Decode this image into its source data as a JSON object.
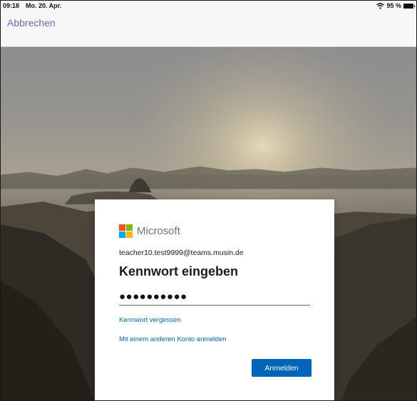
{
  "statusbar": {
    "time": "09:18",
    "date": "Mo. 20. Apr.",
    "battery": "95 %"
  },
  "navbar": {
    "cancel_label": "Abbrechen"
  },
  "login": {
    "brand": "Microsoft",
    "email": "teacher10.test9999@teams.musin.de",
    "heading": "Kennwort eingeben",
    "password_masked": "●●●●●●●●●●",
    "forgot_link": "Kennwort vergessen",
    "other_account_link": "Mit einem anderen Konto anmelden",
    "signin_label": "Anmelden"
  },
  "colors": {
    "accent": "#0067b8",
    "nav_link": "#6b6bb4",
    "ms_red": "#f25022",
    "ms_green": "#7fba00",
    "ms_blue": "#00a4ef",
    "ms_yellow": "#ffb900"
  }
}
